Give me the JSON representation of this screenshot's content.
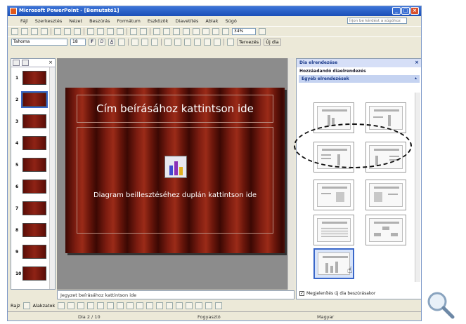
{
  "window": {
    "title": "Microsoft PowerPoint - [Bemutató1]",
    "controls": [
      "_",
      "□",
      "×"
    ]
  },
  "menu": {
    "items": [
      "Fájl",
      "Szerkesztés",
      "Nézet",
      "Beszúrás",
      "Formátum",
      "Eszközök",
      "Diavetítés",
      "Ablak",
      "Súgó"
    ],
    "help_placeholder": "Írjon be kérdést a súgóhoz"
  },
  "standard_toolbar": {
    "zoom": "34%"
  },
  "format_toolbar": {
    "font": "Tahoma",
    "size": "18",
    "bold": "F",
    "italic": "D",
    "underline": "A",
    "design_label": "Tervezés",
    "new_slide_label": "Új dia"
  },
  "slides_pane": {
    "thumbnails": [
      {
        "num": "1"
      },
      {
        "num": "2"
      },
      {
        "num": "3"
      },
      {
        "num": "4"
      },
      {
        "num": "5"
      },
      {
        "num": "6"
      },
      {
        "num": "7"
      },
      {
        "num": "8"
      },
      {
        "num": "9"
      },
      {
        "num": "10"
      }
    ],
    "selected": "2"
  },
  "slide": {
    "title_placeholder": "Cím beírásához kattintson ide",
    "body_placeholder": "Diagram beillesztéséhez duplán kattintson ide"
  },
  "notes": {
    "placeholder": "Jegyzet beírásához kattintson ide"
  },
  "task_pane": {
    "title": "Dia elrendezése",
    "subtitle": "Hozzáadandó diaelrendezés",
    "group_label": "Egyéb elrendezések",
    "checkbox_label": "Megjelenítés új dia beszúrásakor"
  },
  "drawing_toolbar": {
    "draw_label": "Rajz",
    "autoshapes_label": "Alakzatok"
  },
  "status_bar": {
    "slide_info": "Dia 2 / 10",
    "design": "Fogyasztó",
    "language": "Magyar"
  },
  "colors": {
    "title_bar": "#1a4fb7",
    "slide_red": "#7c1c10",
    "task_group": "#c5d3f1"
  }
}
